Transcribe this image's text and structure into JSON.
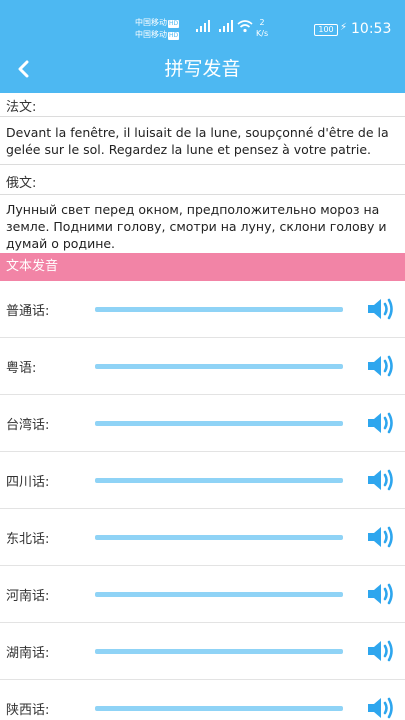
{
  "status_bar": {
    "carrier1": "中国移动",
    "carrier2": "中国移动",
    "hd": "HD",
    "net_speed_value": "2",
    "net_speed_unit": "K/s",
    "battery": "100",
    "time": "10:53"
  },
  "app_bar": {
    "title": "拼写发音"
  },
  "french": {
    "label": "法文:",
    "text": "Devant la fenêtre, il luisait de la lune, soupçonné d'être de la gelée sur le sol. Regardez la lune et pensez à votre patrie."
  },
  "russian": {
    "label": "俄文:",
    "text": "Лунный свет перед окном, предположительно мороз на земле. Подними голову, смотри на луну, склони голову и думай о родине."
  },
  "tts": {
    "header": "文本发音",
    "dialects": [
      {
        "label": "普通话:"
      },
      {
        "label": "粤语:"
      },
      {
        "label": "台湾话:"
      },
      {
        "label": "四川话:"
      },
      {
        "label": "东北话:"
      },
      {
        "label": "河南话:"
      },
      {
        "label": "湖南话:"
      },
      {
        "label": "陕西话:"
      }
    ]
  },
  "colors": {
    "primary": "#4db8f2",
    "header_pink": "#f284a6",
    "slider": "#8fd3f6",
    "speaker": "#2ea6ee"
  }
}
